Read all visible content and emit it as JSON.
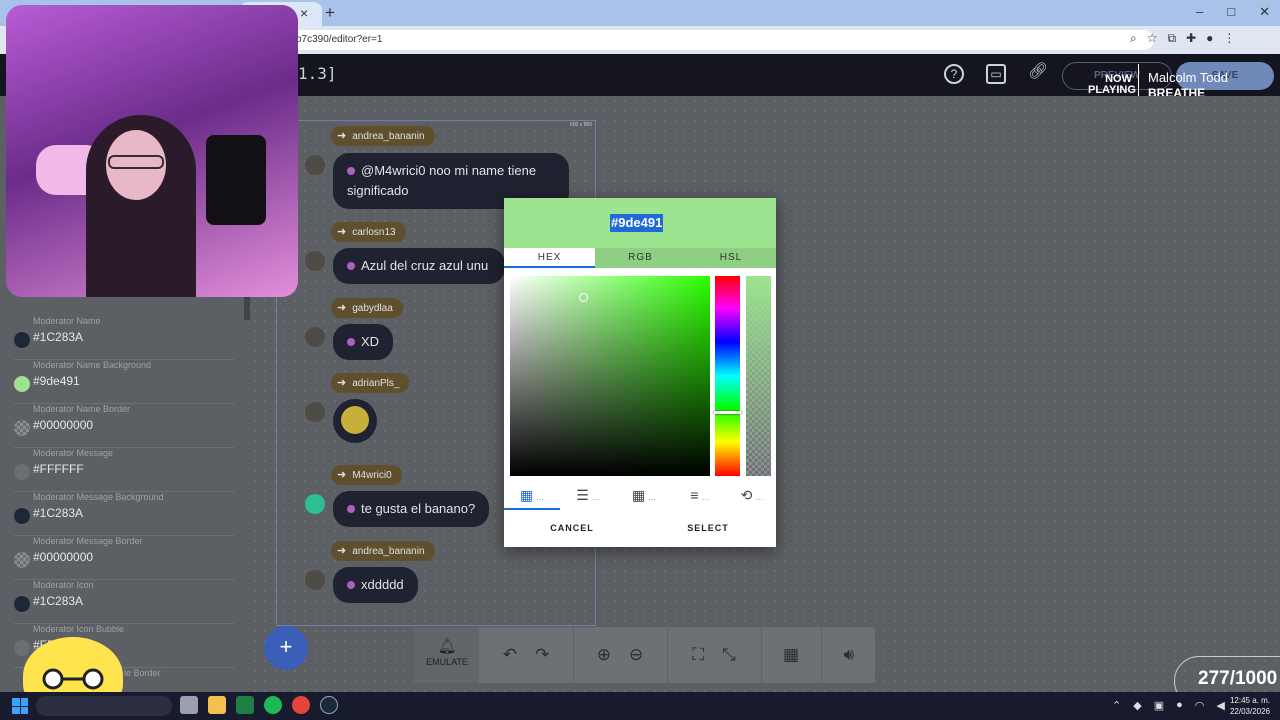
{
  "browser": {
    "url": "b7c390/editor?er=1",
    "tab_close": "×",
    "tab_new": "+",
    "window_controls": [
      "–",
      "□",
      "✕"
    ]
  },
  "app_header": {
    "version": "1.3]",
    "preview_label": "PREVIEW",
    "save_label": "SAVE"
  },
  "now_playing": {
    "label": "NOW PLAYING",
    "artist": "Malcolm Todd",
    "track": "BREATHE"
  },
  "sidebar": {
    "settings": [
      {
        "label": "Moderator Name",
        "value": "#1C283A",
        "color": "#1c283a"
      },
      {
        "label": "Moderator Name Background",
        "value": "#9de491",
        "color": "#9de491"
      },
      {
        "label": "Moderator Name Border",
        "value": "#00000000",
        "color": "transparent"
      },
      {
        "label": "Moderator Message",
        "value": "#FFFFFF",
        "color": "#ffffff"
      },
      {
        "label": "Moderator Message Background",
        "value": "#1C283A",
        "color": "#1c283a"
      },
      {
        "label": "Moderator Message Border",
        "value": "#00000000",
        "color": "transparent"
      },
      {
        "label": "Moderator Icon",
        "value": "#1C283A",
        "color": "#1c283a"
      },
      {
        "label": "Moderator Icon Bubble",
        "value": "#FF",
        "color": "#ffffff"
      },
      {
        "label": "le Border",
        "value": "",
        "color": "transparent"
      }
    ]
  },
  "canvas": {
    "frame_size": "600 x 950"
  },
  "chat": [
    {
      "name": "andrea_bananin",
      "message": "@M4wrici0 noo mi name tiene significado"
    },
    {
      "name": "carlosn13",
      "message": "Azul del cruz azul unu"
    },
    {
      "name": "gabydlaa",
      "message": "XD"
    },
    {
      "name": "adrianPls_",
      "message": ""
    },
    {
      "name": "M4wrici0",
      "message": "te gusta el banano?"
    },
    {
      "name": "andrea_bananin",
      "message": "xddddd"
    }
  ],
  "color_picker": {
    "hex_value": "#9de491",
    "tabs": [
      "HEX",
      "RGB",
      "HSL"
    ],
    "active_tab": "HEX",
    "cancel_label": "CANCEL",
    "select_label": "SELECT",
    "tools": [
      "palette-icon",
      "sliders-icon",
      "grid-icon",
      "list-icon",
      "history-icon"
    ],
    "more_glyph": "…",
    "colors": {
      "header": "#9de491",
      "accent": "#1f6ad6"
    }
  },
  "toolbar": {
    "add_glyph": "+",
    "emulate_label": "EMULATE"
  },
  "counter": {
    "text": "277/1000"
  },
  "taskbar": {
    "time": "12:45 a. m.",
    "date": "22/03/2026"
  }
}
